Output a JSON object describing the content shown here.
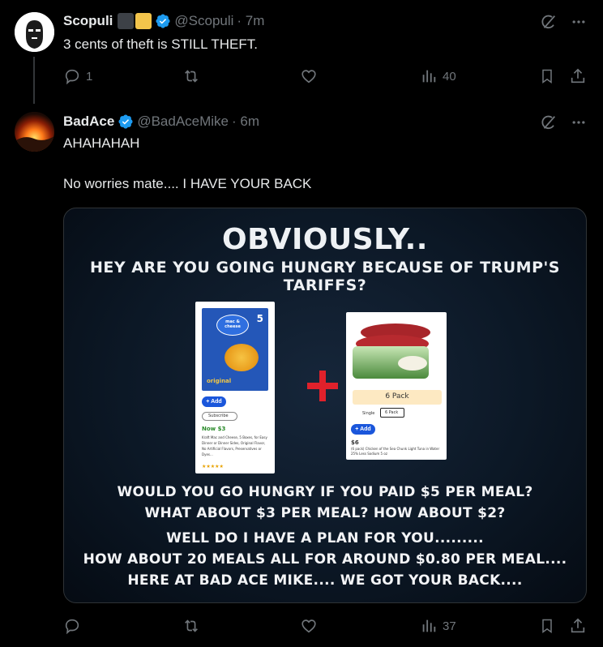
{
  "post1": {
    "name": "Scopuli",
    "handle": "@Scopuli",
    "time": "· 7m",
    "text": "3 cents of theft is STILL THEFT.",
    "replies": "1",
    "views": "40",
    "badge_colors": [
      "#3d4147",
      "#f2c44b"
    ]
  },
  "post2": {
    "name": "BadAce",
    "handle": "@BadAceMike",
    "time": "· 6m",
    "line1": "AHAHAHAH",
    "line2": "No worries mate.... I HAVE YOUR BACK",
    "views": "37"
  },
  "media": {
    "title": "OBVIOUSLY..",
    "subtitle": "HEY ARE YOU GOING HUNGRY BECAUSE OF TRUMP'S TARIFFS?",
    "lines": [
      "WOULD YOU GO HUNGRY IF YOU PAID $5 PER MEAL?",
      "WHAT ABOUT $3 PER MEAL? HOW ABOUT $2?",
      "WELL DO I HAVE A PLAN FOR YOU.........",
      "HOW ABOUT 20 MEALS ALL FOR AROUND $0.80 PER MEAL....",
      "HERE AT BAD ACE MIKE.... WE GOT YOUR BACK...."
    ],
    "card1": {
      "brand": "mac & cheese",
      "count": "5",
      "flavor": "original",
      "add": "+ Add",
      "subscribe": "Subscribe",
      "price": "Now $3",
      "desc": "Kraft Mac and Cheese, 5 Boxes, for Easy Dinner or Dinner Sides, Original Flavor, No Artificial Flavors, Preservatives or Dyes..."
    },
    "card2": {
      "pack": "6 Pack",
      "opt_single": "Single",
      "opt_pack": "6 Pack",
      "add": "+ Add",
      "price": "$6",
      "desc": "(6 pack) Chicken of the Sea Chunk Light Tuna in Water 25% Less Sodium 5 oz"
    }
  },
  "colors": {
    "verified": "#1d9bf0",
    "muted": "#71767b",
    "plus": "#e0212b"
  },
  "icons": [
    "grok-icon",
    "more-icon",
    "reply-icon",
    "repost-icon",
    "like-icon",
    "views-icon",
    "bookmark-icon",
    "share-icon",
    "verified-icon"
  ]
}
